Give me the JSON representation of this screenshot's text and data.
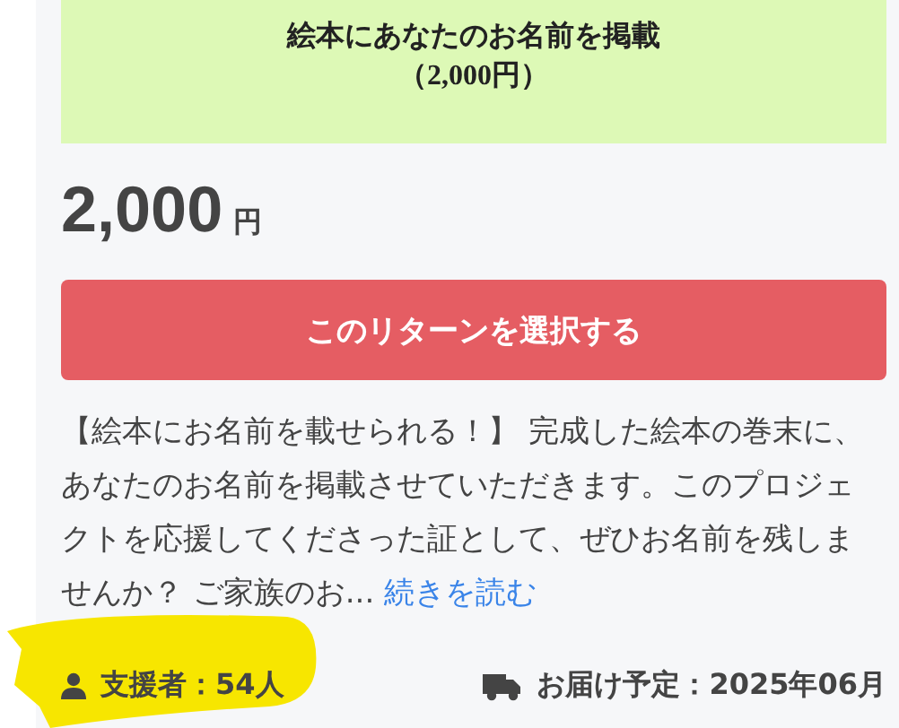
{
  "reward": {
    "banner": {
      "title": "絵本にあなたのお名前を掲載",
      "subtitle": "（2,000円）"
    },
    "price": {
      "amount": "2,000",
      "unit": "円"
    },
    "select_button": "このリターンを選択する",
    "description": "【絵本にお名前を載せられる！】 完成した絵本の巻末に、あなたのお名前を掲載させていただきます。このプロジェクトを応援してくださった証として、ぜひお名前を残しませんか？ ご家族のお...",
    "read_more_link": "続きを読む",
    "supporters": "支援者：54人",
    "delivery": "お届け予定：2025年06月"
  }
}
